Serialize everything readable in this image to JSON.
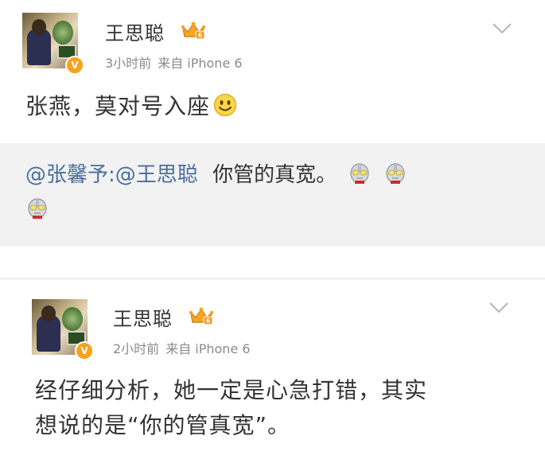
{
  "posts": [
    {
      "author": "王思聪",
      "time": "3小时前",
      "source": "来自 iPhone 6",
      "text": "张燕，莫对号入座",
      "repost": {
        "mention1": "@张馨予",
        "separator": ":",
        "mention2": "@王思聪",
        "text": "你管的真宽。"
      }
    },
    {
      "author": "王思聪",
      "time": "2小时前",
      "source": "来自 iPhone 6",
      "text_line1": "经仔细分析，她一定是心急打错，其实",
      "text_line2": "想说的是“你的管真宽”。"
    }
  ],
  "badges": {
    "verified_symbol": "V",
    "vip_level": "6"
  },
  "icons": {
    "verified": "verified-badge-icon",
    "crown": "vip-crown-icon",
    "chevron": "chevron-down-icon",
    "smiley": "smiley-emoji-icon",
    "ultraman": "ultraman-emoji-icon"
  },
  "colors": {
    "mention": "#4a6d9e",
    "verified": "#f7a21b",
    "crown": "#f5a623",
    "repost_bg": "#f2f2f2",
    "meta": "#8a8a8a"
  }
}
